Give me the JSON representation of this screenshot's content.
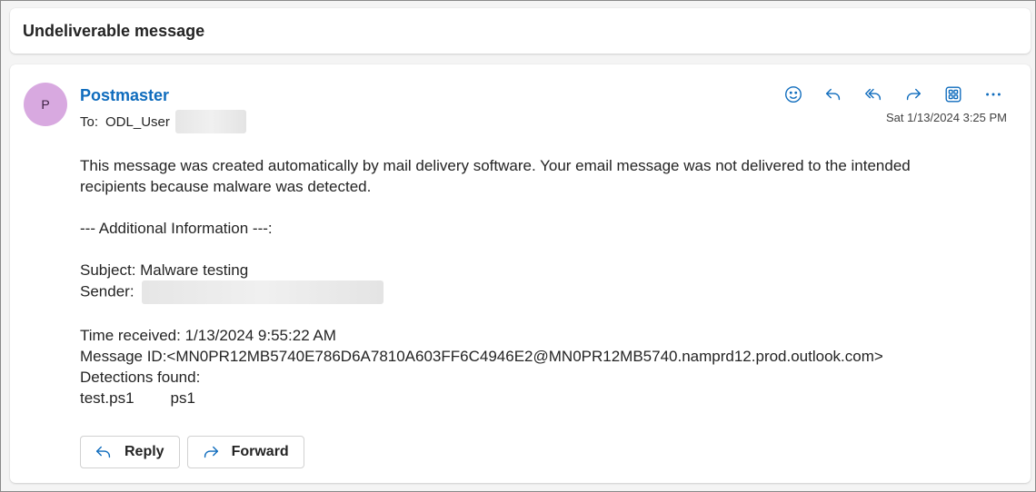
{
  "subject": "Undeliverable message",
  "message": {
    "avatar_initial": "P",
    "sender": "Postmaster",
    "to_label": "To:",
    "to_value": "ODL_User",
    "timestamp": "Sat 1/13/2024 3:25 PM",
    "actions": [
      {
        "name": "emoji-icon"
      },
      {
        "name": "reply-icon"
      },
      {
        "name": "reply-all-icon"
      },
      {
        "name": "forward-icon"
      },
      {
        "name": "apps-icon"
      },
      {
        "name": "more-icon"
      }
    ],
    "body": {
      "intro": "This message was created automatically by mail delivery software. Your email message was not delivered to the intended recipients because malware was detected.",
      "additional_header": "--- Additional Information ---:",
      "subject_line": "Subject: Malware testing",
      "sender_label": "Sender:",
      "time_received": "Time received: 1/13/2024 9:55:22 AM",
      "message_id": "Message ID:<MN0PR12MB5740E786D6A7810A603FF6C4946E2@MN0PR12MB5740.namprd12.prod.outlook.com>",
      "detections_label": "Detections found:",
      "detection_file": "test.ps1",
      "detection_type": "ps1"
    },
    "buttons": {
      "reply_label": "Reply",
      "forward_label": "Forward"
    }
  },
  "colors": {
    "accent": "#0f6cbd",
    "avatar_bg": "#d8a9e0",
    "icon": "#0f6cbd"
  }
}
